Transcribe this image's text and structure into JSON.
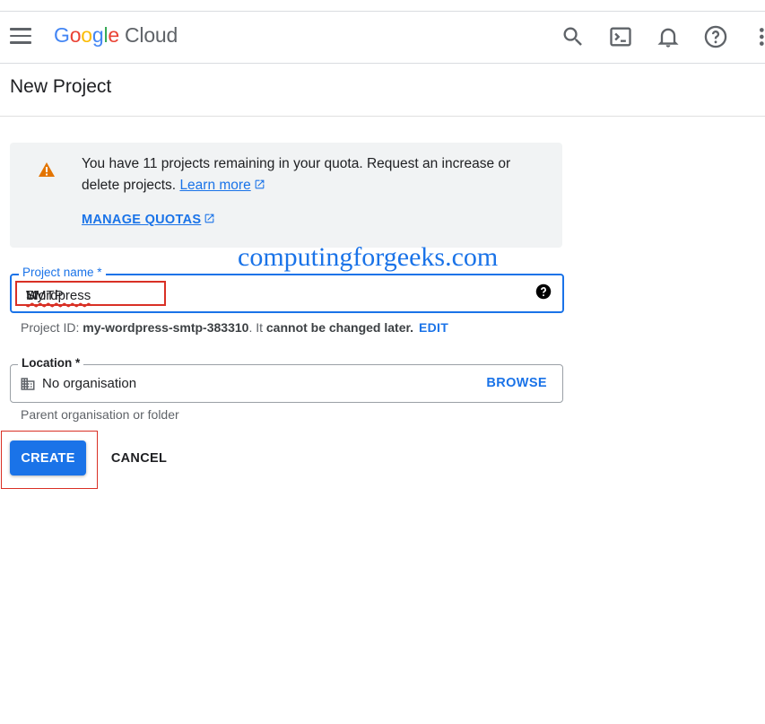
{
  "header": {
    "logo_google": [
      "G",
      "o",
      "o",
      "g",
      "l",
      "e"
    ],
    "logo_cloud": "Cloud",
    "icons": [
      "search-icon",
      "terminal-icon",
      "bell-icon",
      "help-icon",
      "more-vert-icon"
    ]
  },
  "page": {
    "title": "New Project"
  },
  "quota": {
    "message": "You have 11 projects remaining in your quota. Request an increase or delete projects.",
    "learn_more": "Learn more",
    "manage_quotas": "MANAGE QUOTAS"
  },
  "watermark": "computingforgeeks.com",
  "project_name": {
    "label": "Project name *",
    "value_part1": "My",
    "value_part2": "Wordpress",
    "value_part3": "SMTP"
  },
  "project_id": {
    "prefix": "Project ID: ",
    "id": "my-wordpress-smtp-383310",
    "middle": ". It ",
    "note": "cannot be changed later.",
    "edit": "EDIT"
  },
  "location": {
    "label": "Location *",
    "value": "No organisation",
    "browse": "BROWSE",
    "hint": "Parent organisation or folder"
  },
  "actions": {
    "create": "CREATE",
    "cancel": "CANCEL"
  },
  "colors": {
    "primary": "#1a73e8",
    "warning": "#e37400",
    "error": "#d93025",
    "grey_bg": "#f1f3f4"
  }
}
